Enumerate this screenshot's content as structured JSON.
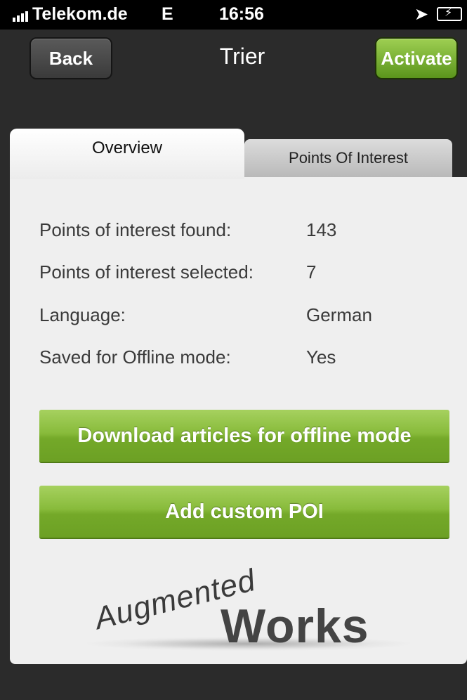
{
  "status_bar": {
    "carrier": "Telekom.de",
    "network": "E",
    "time": "16:56",
    "location_icon": "location-arrow-icon",
    "battery_icon": "battery-charging-icon"
  },
  "nav": {
    "title": "Trier",
    "back_label": "Back",
    "activate_label": "Activate"
  },
  "tabs": [
    {
      "label": "Overview",
      "active": true
    },
    {
      "label": "Points Of Interest",
      "active": false
    }
  ],
  "overview": {
    "rows": [
      {
        "label": "Points of interest found:",
        "value": "143"
      },
      {
        "label": "Points of interest selected:",
        "value": "7"
      },
      {
        "label": "Language:",
        "value": "German"
      },
      {
        "label": "Saved for Offline mode:",
        "value": "Yes"
      }
    ],
    "download_button": "Download articles for offline mode",
    "add_poi_button": "Add custom POI"
  },
  "logo": {
    "word1": "Augmented",
    "word2": "Works"
  },
  "colors": {
    "accent_green": "#88bb3b",
    "nav_background": "#2b2b2b",
    "panel_background": "#efefef"
  }
}
